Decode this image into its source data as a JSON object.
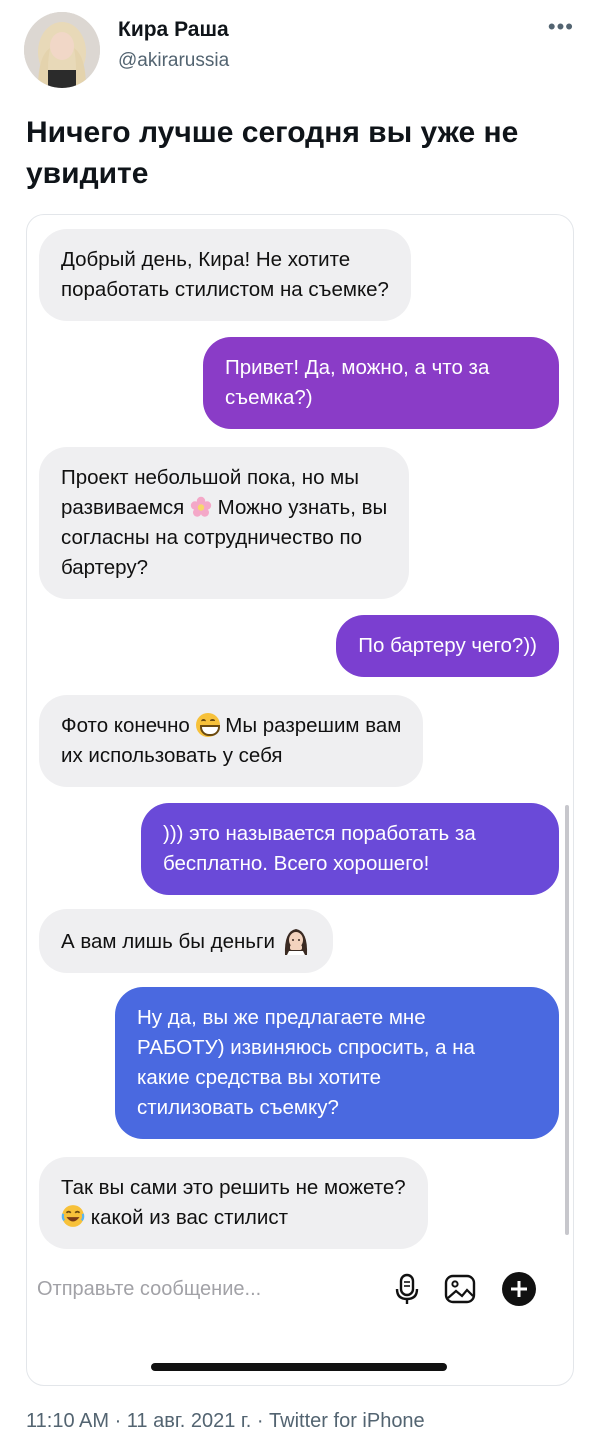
{
  "author": {
    "name": "Кира Раша",
    "handle": "@akirarussia"
  },
  "tweet": {
    "text": "Ничего лучше сегодня вы уже не увидите"
  },
  "messages": [
    {
      "side": "in",
      "lines": [
        "Добрый день, Кира! Не хотите",
        "поработать стилистом на съемке?"
      ]
    },
    {
      "side": "out",
      "lines": [
        "Привет! Да, можно, а что за",
        "съемка?)"
      ],
      "color": "#8a3cc7"
    },
    {
      "side": "in",
      "lines": [
        "Проект небольшой пока, но мы",
        "развиваемся",
        "Можно узнать, вы",
        "согласны на сотрудничество по",
        "бартеру?"
      ]
    },
    {
      "side": "out",
      "lines": [
        "По бартеру чего?))"
      ],
      "color": "#7b3fd0"
    },
    {
      "side": "in",
      "lines": [
        "Фото конечно",
        "Мы разрешим вам",
        "их использовать у себя"
      ]
    },
    {
      "side": "out",
      "lines": [
        ")))  это называется поработать за",
        "бесплатно. Всего хорошего!"
      ],
      "color": "#6a4ad8"
    },
    {
      "side": "in",
      "lines": [
        "А вам лишь бы деньги"
      ]
    },
    {
      "side": "out",
      "lines": [
        "Ну да, вы же предлагаете мне",
        "РАБОТУ) извиняюсь спросить, а на",
        "какие средства вы хотите",
        "стилизовать съемку?"
      ],
      "color": "#4a69e0"
    },
    {
      "side": "in",
      "lines": [
        "Так вы сами это решить не можете?",
        "какой из вас стилист"
      ]
    }
  ],
  "composer": {
    "placeholder": "Отправьте сообщение..."
  },
  "meta": {
    "text": "11:10 AM · 11 авг. 2021 г. · Twitter for iPhone"
  },
  "icons": [
    "more-icon",
    "flower-emoji-icon",
    "grin-emoji-icon",
    "facepalm-emoji-icon",
    "laugh-emoji-icon",
    "microphone-icon",
    "gallery-icon",
    "plus-icon"
  ]
}
